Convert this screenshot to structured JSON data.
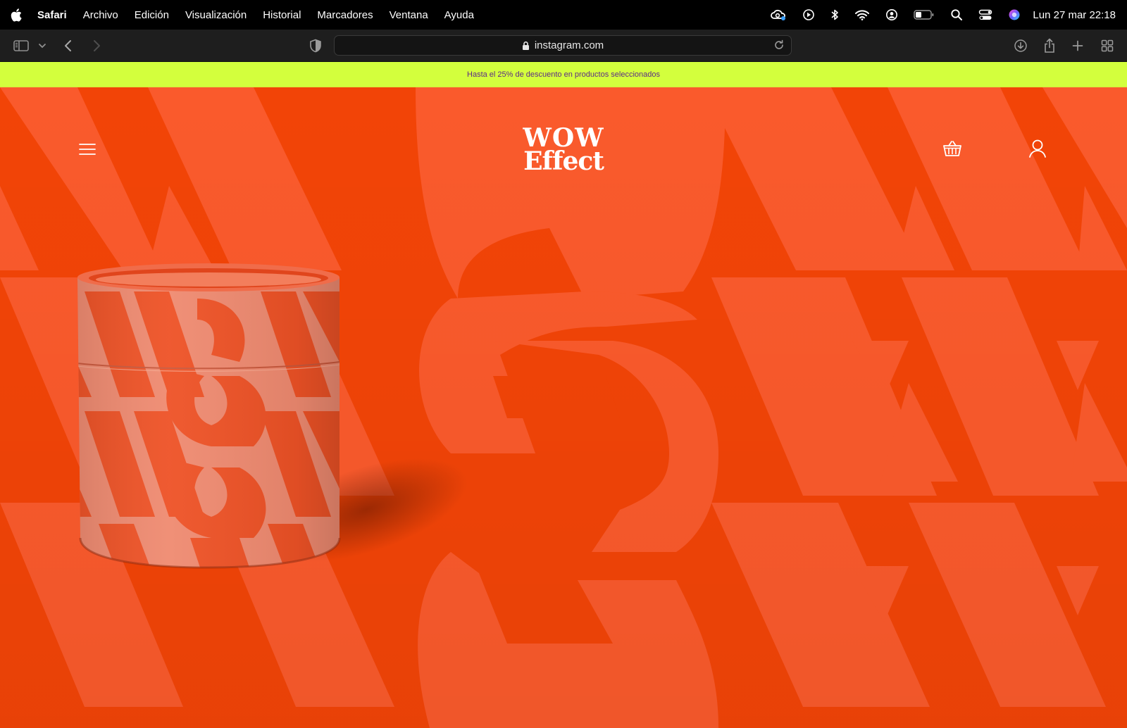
{
  "menubar": {
    "app_name": "Safari",
    "menus": [
      "Archivo",
      "Edición",
      "Visualización",
      "Historial",
      "Marcadores",
      "Ventana",
      "Ayuda"
    ],
    "clock": "Lun 27 mar  22:18",
    "status_icons": [
      "creative-cloud-icon",
      "play-icon",
      "bluetooth-icon",
      "wifi-icon",
      "user-icon",
      "battery-icon",
      "search-icon",
      "control-center-icon",
      "siri-icon"
    ]
  },
  "browser": {
    "url": "instagram.com"
  },
  "promo": {
    "text": "Hasta el 25% de descuento en productos seleccionados"
  },
  "site": {
    "logo_line1": "WOW",
    "logo_line2": "Effect"
  },
  "colors": {
    "hero_bg": "#f24407",
    "hero_pattern": "#fa5a2c",
    "promo_bg": "#d3ff3d",
    "promo_text": "#5b2a86"
  }
}
